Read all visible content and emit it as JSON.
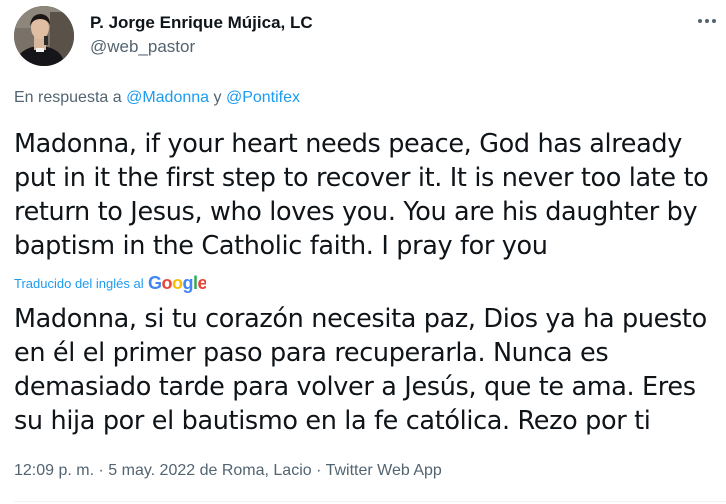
{
  "author": {
    "name": "P. Jorge Enrique Mújica, LC",
    "handle": "@web_pastor"
  },
  "reply": {
    "prefix": "En respuesta a",
    "mention_1": "@Madonna",
    "conjunction": "y",
    "mention_2": "@Pontifex"
  },
  "tweet": {
    "original_lines": [
      "Madonna, if your heart needs peace, God has already",
      "put in it the first step to recover it. It is never too late to",
      "return to Jesus, who loves you. You are his daughter by",
      "baptism in the Catholic faith. I pray for you"
    ],
    "translation_label": "Traducido del inglés al",
    "translator_logo": "Google",
    "translated_lines": [
      "Madonna, si tu corazón necesita paz, Dios ya ha puesto",
      "en él el primer paso para recuperarla. Nunca es",
      "demasiado tarde para volver a Jesús, que te ama. Eres",
      "su hija por el bautismo en la fe católica. Rezo por ti"
    ]
  },
  "meta": {
    "time": "12:09 p. m.",
    "date": "5 may. 2022 de Roma, Lacio",
    "client": "Twitter Web App",
    "separator": "·"
  },
  "icons": {
    "more": "more-horizontal-icon",
    "avatar": "profile-photo"
  },
  "colors": {
    "text": "#0f1419",
    "secondary": "#536471",
    "link": "#1d9bf0",
    "google_blue": "#4285F4",
    "google_red": "#EA4335",
    "google_yellow": "#FBBC05",
    "google_green": "#34A853"
  }
}
